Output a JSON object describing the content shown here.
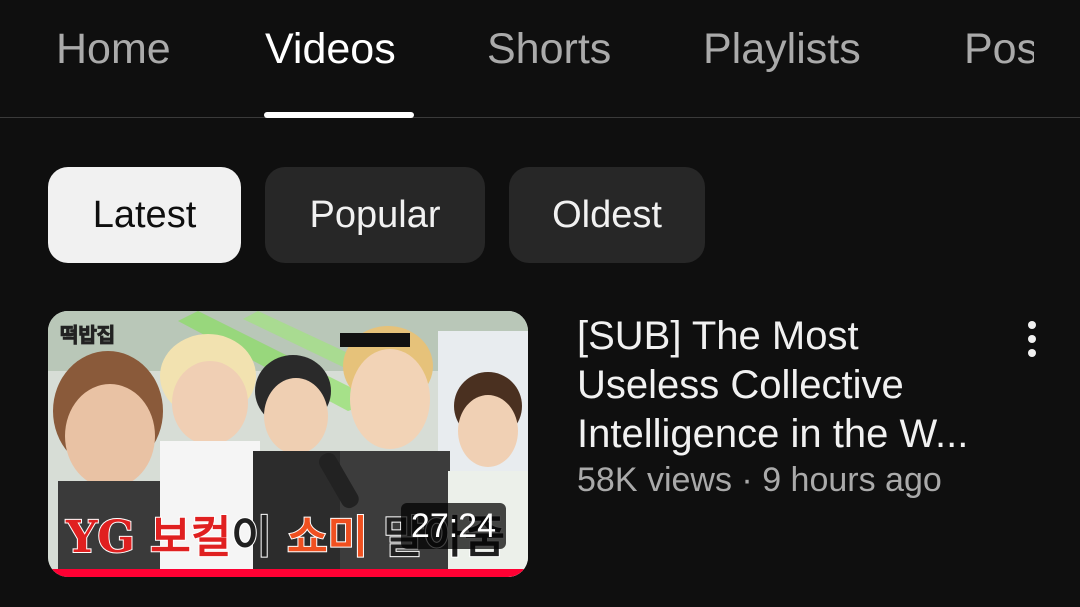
{
  "tabs": [
    {
      "label": "Home",
      "active": false
    },
    {
      "label": "Videos",
      "active": true
    },
    {
      "label": "Shorts",
      "active": false
    },
    {
      "label": "Playlists",
      "active": false
    },
    {
      "label": "Pos",
      "active": false
    }
  ],
  "filters": {
    "chips": [
      {
        "label": "Latest",
        "selected": true
      },
      {
        "label": "Popular",
        "selected": false
      },
      {
        "label": "Oldest",
        "selected": false
      }
    ]
  },
  "video": {
    "title": "[SUB] The Most Useless Collective Intelligence in the W...",
    "views": "58K views",
    "separator": "·",
    "age": "9 hours ago",
    "duration": "27:24",
    "thumbnail": {
      "corner_text": "떡밥집",
      "caption_part1": "YG 보컬",
      "caption_part2": "이 ",
      "caption_part3": "쇼미",
      "caption_part4": " 말아줌"
    },
    "watch_progress": 1.0,
    "more_icon": "vertical-ellipsis-icon"
  },
  "colors": {
    "background": "#0f0f0f",
    "chip_selected_bg": "#f1f1f1",
    "chip_bg": "#272727",
    "progress": "#ff0033",
    "secondary_text": "#aaaaaa"
  }
}
